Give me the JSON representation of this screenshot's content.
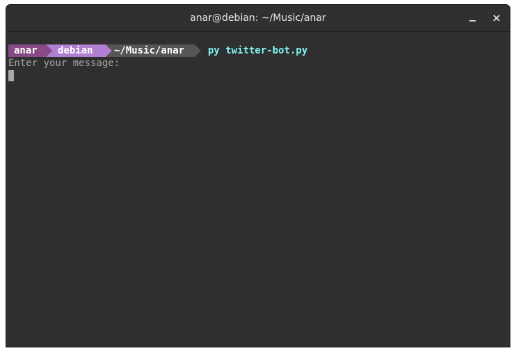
{
  "window": {
    "title": "anar@debian: ~/Music/anar"
  },
  "titlebar_buttons": {
    "minimize": "minimize-icon",
    "close": "close-icon"
  },
  "prompt": {
    "user": "anar",
    "host": "debian",
    "path": "~/Music/anar",
    "colors": {
      "user_bg": "#874a86",
      "host_bg": "#b07fd1",
      "path_bg": "#555555",
      "command": "#7ff3f3"
    }
  },
  "command": "py twitter-bot.py",
  "output": {
    "line1": "Enter your message:"
  }
}
